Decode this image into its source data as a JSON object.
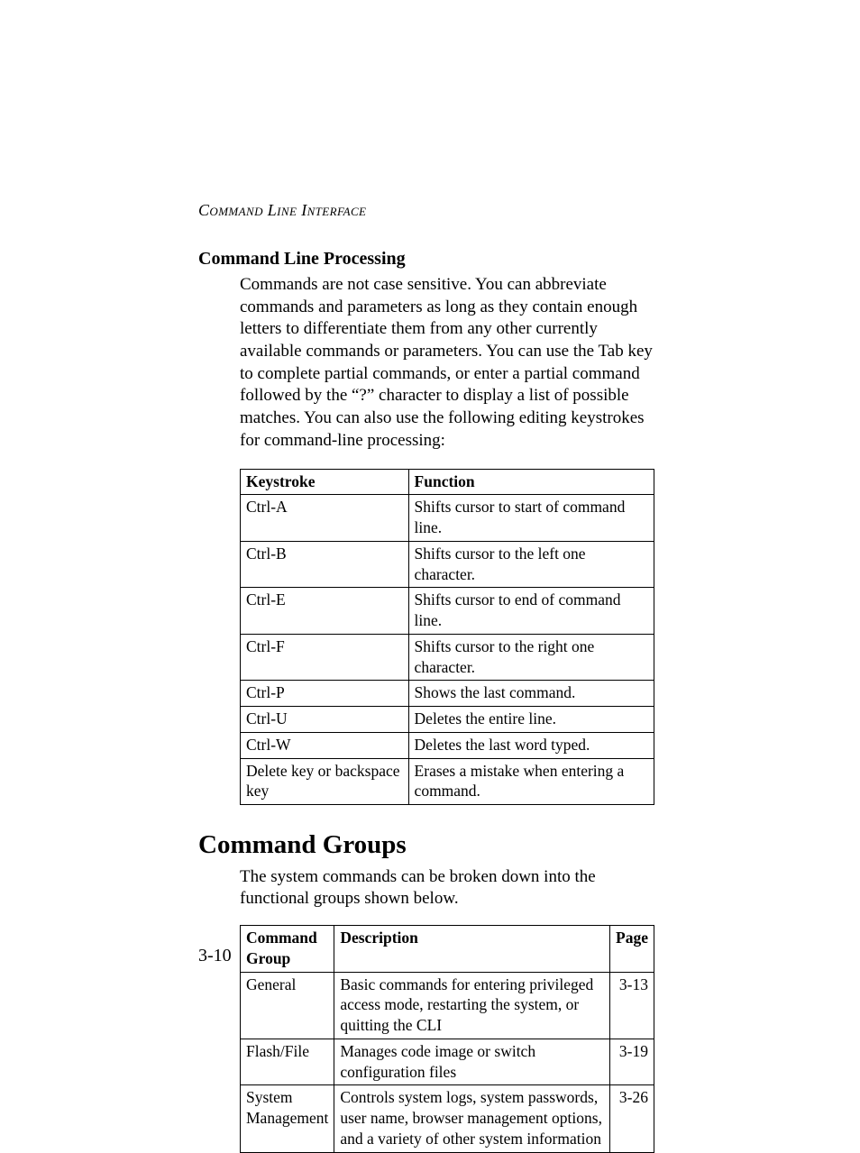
{
  "runningHead": "Command Line Interface",
  "section1": {
    "title": "Command Line Processing",
    "paragraph": "Commands are not case sensitive. You can abbreviate commands and parameters as long as they contain enough letters to differentiate them from any other currently available commands or parameters. You can use the Tab key to complete partial commands, or enter a partial command followed by the “?” character to display a list of possible matches. You can also use the following editing keystrokes for command-line processing:"
  },
  "keystrokeTable": {
    "headers": {
      "c1": "Keystroke",
      "c2": "Function"
    },
    "rows": [
      {
        "k": "Ctrl-A",
        "f": "Shifts cursor to start of command line."
      },
      {
        "k": "Ctrl-B",
        "f": "Shifts cursor to the left one character."
      },
      {
        "k": "Ctrl-E",
        "f": "Shifts cursor to end of command line."
      },
      {
        "k": "Ctrl-F",
        "f": "Shifts cursor to the right one character."
      },
      {
        "k": "Ctrl-P",
        "f": "Shows the last command."
      },
      {
        "k": "Ctrl-U",
        "f": "Deletes the entire line."
      },
      {
        "k": "Ctrl-W",
        "f": "Deletes the last word typed."
      },
      {
        "k": "Delete key or backspace key",
        "f": "Erases a mistake when entering a command."
      }
    ]
  },
  "section2": {
    "title": "Command Groups",
    "paragraph": "The system commands can be broken down into the functional groups shown below."
  },
  "commandGroupsTable": {
    "headers": {
      "c1": "Command Group",
      "c2": "Description",
      "c3": "Page"
    },
    "rows": [
      {
        "g": "General",
        "d": "Basic commands for entering privileged access mode, restarting the system, or quitting the CLI",
        "p": "3-13"
      },
      {
        "g": "Flash/File",
        "d": "Manages code image or switch configuration files",
        "p": "3-19"
      },
      {
        "g": "System Management",
        "d": "Controls system logs, system passwords, user name, browser management options, and a variety of other system information",
        "p": "3-26"
      }
    ]
  },
  "pageNumber": "3-10"
}
